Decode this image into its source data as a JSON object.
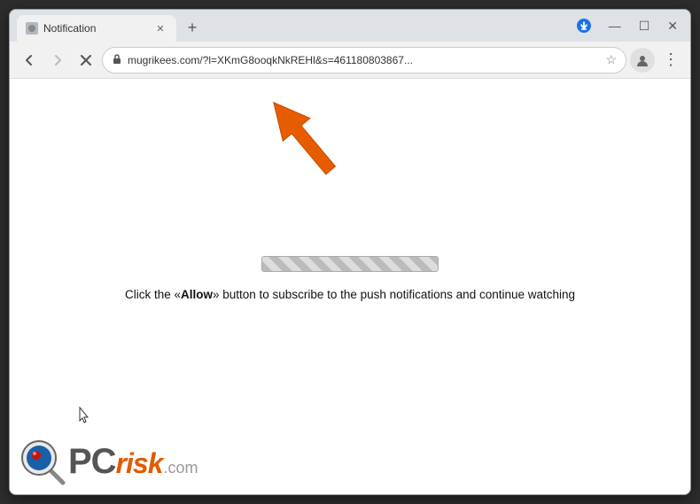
{
  "window": {
    "title": "Notification",
    "controls": {
      "minimize": "—",
      "maximize": "☐",
      "close": "✕"
    }
  },
  "tabs": [
    {
      "label": "Notification",
      "active": true
    }
  ],
  "toolbar": {
    "url": "mugrikees.com/?l=XKmG8ooqkNkREHl&s=461180803867...",
    "back_disabled": false,
    "forward_disabled": true,
    "stop": true
  },
  "page": {
    "progress_bar_visible": true,
    "notification_text": "Click the «Allow» button to subscribe to the push notifications and continue watching",
    "allow_word": "Allow"
  },
  "pcrisk": {
    "text_pc": "PC",
    "text_risk": "risk",
    "text_com": ".com"
  }
}
